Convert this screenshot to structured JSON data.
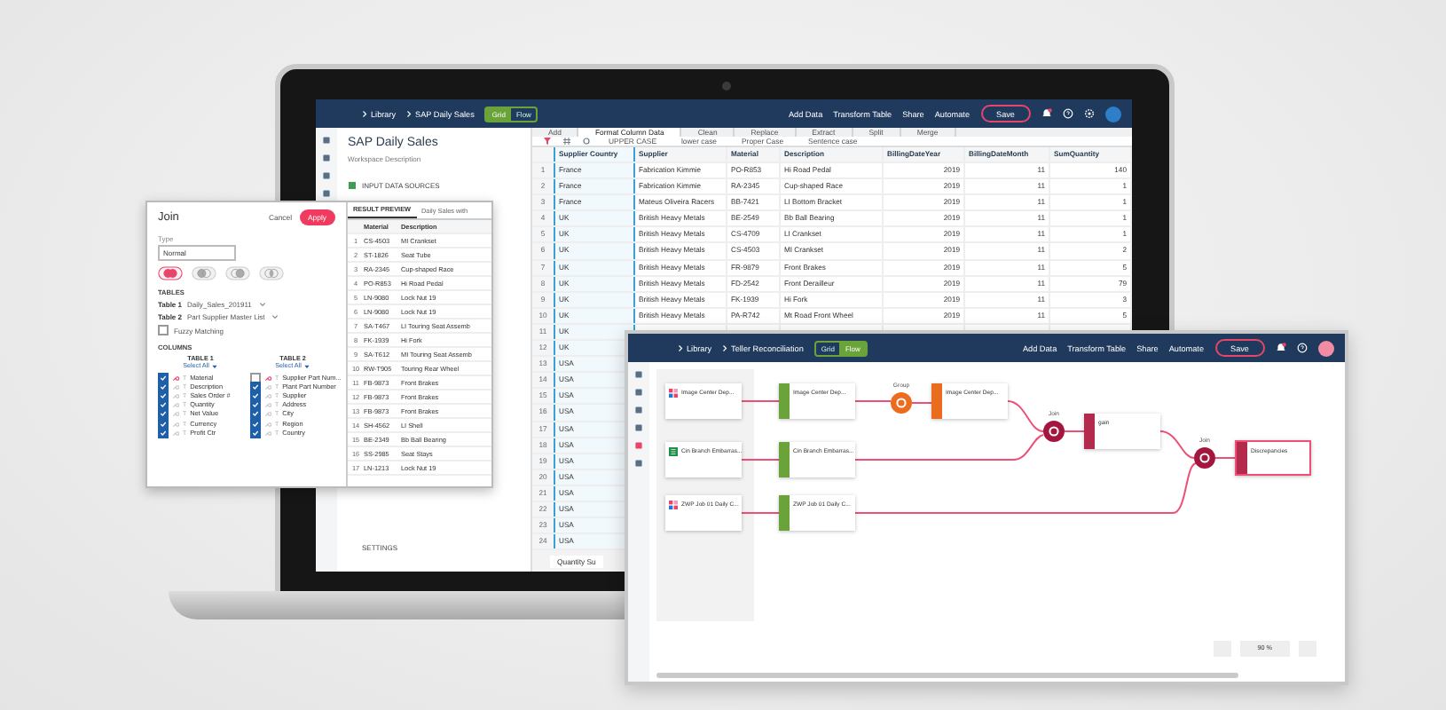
{
  "main_window": {
    "breadcrumb": [
      "Library",
      "SAP Daily Sales"
    ],
    "view_toggle": [
      {
        "label": "Grid",
        "selected": true
      },
      {
        "label": "Flow",
        "selected": false
      }
    ],
    "actions": [
      "Add Data",
      "Transform Table",
      "Share",
      "Automate"
    ],
    "save": "Save",
    "workspace": {
      "title": "SAP Daily Sales",
      "description": "Workspace Description",
      "sections": [
        "INPUT DATA SOURCES",
        "SETTINGS"
      ]
    },
    "tabs": [
      {
        "label": "Add",
        "selected": false
      },
      {
        "label": "Format Column Data",
        "selected": true
      },
      {
        "label": "Clean",
        "selected": false
      },
      {
        "label": "Replace",
        "selected": false
      },
      {
        "label": "Extract",
        "selected": false
      },
      {
        "label": "Split",
        "selected": false
      },
      {
        "label": "Merge",
        "selected": false
      }
    ],
    "case_options": [
      "UPPER CASE",
      "lower case",
      "Proper Case",
      "Sentence case"
    ],
    "table": {
      "columns": [
        "Supplier Country",
        "Supplier",
        "Material",
        "Description",
        "BillingDateYear",
        "BillingDateMonth",
        "SumQuantity"
      ],
      "rows": [
        {
          "n": "1",
          "cells": [
            "France",
            "Fabrication Kimmie",
            "PO-R853",
            "Hi Road Pedal",
            "2019",
            "11",
            "140"
          ]
        },
        {
          "n": "2",
          "cells": [
            "France",
            "Fabrication Kimmie",
            "RA-2345",
            "Cup-shaped Race",
            "2019",
            "11",
            "1"
          ]
        },
        {
          "n": "3",
          "cells": [
            "France",
            "Mateus Oliveira Racers",
            "BB-7421",
            "LI Bottom Bracket",
            "2019",
            "11",
            "1"
          ]
        },
        {
          "n": "4",
          "cells": [
            "UK",
            "British Heavy Metals",
            "BE-2549",
            "Bb Ball Bearing",
            "2019",
            "11",
            "1"
          ]
        },
        {
          "n": "5",
          "cells": [
            "UK",
            "British Heavy Metals",
            "CS-4709",
            "LI Crankset",
            "2019",
            "11",
            "1"
          ]
        },
        {
          "n": "6",
          "cells": [
            "UK",
            "British Heavy Metals",
            "CS-4503",
            "MI Crankset",
            "2019",
            "11",
            "2"
          ]
        },
        {
          "n": "7",
          "cells": [
            "UK",
            "British Heavy Metals",
            "FR-9879",
            "Front Brakes",
            "2019",
            "11",
            "5"
          ]
        },
        {
          "n": "8",
          "cells": [
            "UK",
            "British Heavy Metals",
            "FD-2542",
            "Front Derailleur",
            "2019",
            "11",
            "79"
          ]
        },
        {
          "n": "9",
          "cells": [
            "UK",
            "British Heavy Metals",
            "FK-1939",
            "Hi Fork",
            "2019",
            "11",
            "3"
          ]
        },
        {
          "n": "10",
          "cells": [
            "UK",
            "British Heavy Metals",
            "PA-R742",
            "Mt Road Front Wheel",
            "2019",
            "11",
            "5"
          ]
        },
        {
          "n": "11",
          "cells": [
            "UK"
          ]
        },
        {
          "n": "12",
          "cells": [
            "UK"
          ]
        },
        {
          "n": "13",
          "cells": [
            "USA"
          ]
        },
        {
          "n": "14",
          "cells": [
            "USA"
          ]
        },
        {
          "n": "15",
          "cells": [
            "USA"
          ]
        },
        {
          "n": "16",
          "cells": [
            "USA"
          ]
        },
        {
          "n": "17",
          "cells": [
            "USA"
          ]
        },
        {
          "n": "18",
          "cells": [
            "USA"
          ]
        },
        {
          "n": "19",
          "cells": [
            "USA"
          ]
        },
        {
          "n": "20",
          "cells": [
            "USA"
          ]
        },
        {
          "n": "21",
          "cells": [
            "USA"
          ]
        },
        {
          "n": "22",
          "cells": [
            "USA"
          ]
        },
        {
          "n": "23",
          "cells": [
            "USA"
          ]
        },
        {
          "n": "24",
          "cells": [
            "USA"
          ]
        }
      ]
    },
    "sheet_tab": "Quantity Su"
  },
  "join_panel": {
    "title": "Join",
    "cancel": "Cancel",
    "apply": "Apply",
    "type_label": "Type",
    "type_value": "Normal",
    "join_types": [
      {
        "kind": "outer",
        "selected": true
      },
      {
        "kind": "left",
        "selected": false
      },
      {
        "kind": "right",
        "selected": false
      },
      {
        "kind": "inner",
        "selected": false
      }
    ],
    "tables_heading": "TABLES",
    "tables": [
      {
        "label": "Table 1",
        "value": "Daily_Sales_201911"
      },
      {
        "label": "Table 2",
        "value": "Part Supplier Master List"
      }
    ],
    "fuzzy": {
      "label": "Fuzzy Matching",
      "checked": false
    },
    "columns_heading": "COLUMNS",
    "column_lists": [
      {
        "heading": "TABLE 1",
        "select": "Select All",
        "items": [
          {
            "name": "Material",
            "type": "T",
            "checked": true,
            "key": true
          },
          {
            "name": "Description",
            "type": "T",
            "checked": true,
            "key": false
          },
          {
            "name": "Sales Order #",
            "type": "T",
            "checked": true,
            "key": false
          },
          {
            "name": "Quantity",
            "type": "T",
            "checked": true,
            "key": false
          },
          {
            "name": "Net Value",
            "type": "T",
            "checked": true,
            "key": false
          },
          {
            "name": "Currency",
            "type": "T",
            "checked": true,
            "key": false
          },
          {
            "name": "Profit Ctr",
            "type": "T",
            "checked": true,
            "key": false
          }
        ]
      },
      {
        "heading": "TABLE 2",
        "select": "Select All",
        "items": [
          {
            "name": "Supplier Part Num...",
            "type": "T",
            "checked": false,
            "key": true
          },
          {
            "name": "Plant Part Number",
            "type": "T",
            "checked": true,
            "key": false
          },
          {
            "name": "Supplier",
            "type": "T",
            "checked": true,
            "key": false
          },
          {
            "name": "Address",
            "type": "T",
            "checked": true,
            "key": false
          },
          {
            "name": "City",
            "type": "T",
            "checked": true,
            "key": false
          },
          {
            "name": "Region",
            "type": "T",
            "checked": true,
            "key": false
          },
          {
            "name": "Country",
            "type": "T",
            "checked": true,
            "key": false
          }
        ]
      }
    ]
  },
  "result_preview": {
    "tabs": [
      {
        "label": "RESULT PREVIEW",
        "selected": true
      },
      {
        "label": "Daily Sales with",
        "selected": false
      }
    ],
    "columns": [
      "Material",
      "Description"
    ],
    "rows": [
      {
        "n": "1",
        "cells": [
          "CS-4503",
          "MI Crankset"
        ]
      },
      {
        "n": "2",
        "cells": [
          "ST-1826",
          "Seat Tube"
        ]
      },
      {
        "n": "3",
        "cells": [
          "RA-2345",
          "Cup-shaped Race"
        ]
      },
      {
        "n": "4",
        "cells": [
          "PO-R853",
          "Hi Road Pedal"
        ]
      },
      {
        "n": "5",
        "cells": [
          "LN-9080",
          "Lock Nut 19"
        ]
      },
      {
        "n": "6",
        "cells": [
          "LN-9080",
          "Lock Nut 19"
        ]
      },
      {
        "n": "7",
        "cells": [
          "SA-T467",
          "LI Touring Seat Assemb"
        ]
      },
      {
        "n": "8",
        "cells": [
          "FK-1939",
          "Hi Fork"
        ]
      },
      {
        "n": "9",
        "cells": [
          "SA-T612",
          "MI Touring Seat Assemb"
        ]
      },
      {
        "n": "10",
        "cells": [
          "RW-T905",
          "Touring Rear Wheel"
        ]
      },
      {
        "n": "11",
        "cells": [
          "FB-9873",
          "Front Brakes"
        ]
      },
      {
        "n": "12",
        "cells": [
          "FB-9873",
          "Front Brakes"
        ]
      },
      {
        "n": "13",
        "cells": [
          "FB-9873",
          "Front Brakes"
        ]
      },
      {
        "n": "14",
        "cells": [
          "SH-4562",
          "LI Shell"
        ]
      },
      {
        "n": "15",
        "cells": [
          "BE-2349",
          "Bb Ball Bearing"
        ]
      },
      {
        "n": "16",
        "cells": [
          "SS-2985",
          "Seat Stays"
        ]
      },
      {
        "n": "17",
        "cells": [
          "LN-1213",
          "Lock Nut 19"
        ]
      }
    ]
  },
  "flow_window": {
    "breadcrumb": [
      "Library",
      "Teller Reconciliation"
    ],
    "view_toggle": [
      {
        "label": "Grid",
        "selected": false
      },
      {
        "label": "Flow",
        "selected": true
      }
    ],
    "actions": [
      "Add Data",
      "Transform Table",
      "Share",
      "Automate"
    ],
    "save": "Save",
    "nodes": [
      {
        "kind": "app_source",
        "label": "Image Center Dep..."
      },
      {
        "kind": "sheet_source",
        "label": "Cin Branch Embarras..."
      },
      {
        "kind": "app_source",
        "label": "ZWP Job 01 Daily C..."
      },
      {
        "kind": "dataset",
        "label": "Image Center Dep..."
      },
      {
        "kind": "dataset",
        "label": "Cin Branch Embarras..."
      },
      {
        "kind": "dataset",
        "label": "ZWP Job 01 Daily C..."
      },
      {
        "kind": "group_result",
        "label": "Image Center Dep..."
      },
      {
        "kind": "join_result",
        "label": "gain"
      },
      {
        "kind": "output",
        "label": "Discrepancies"
      }
    ],
    "operations": [
      {
        "kind": "group",
        "label": "Group"
      },
      {
        "kind": "join",
        "label": "Join"
      },
      {
        "kind": "join",
        "label": "Join"
      }
    ],
    "zoom": "90 %"
  }
}
